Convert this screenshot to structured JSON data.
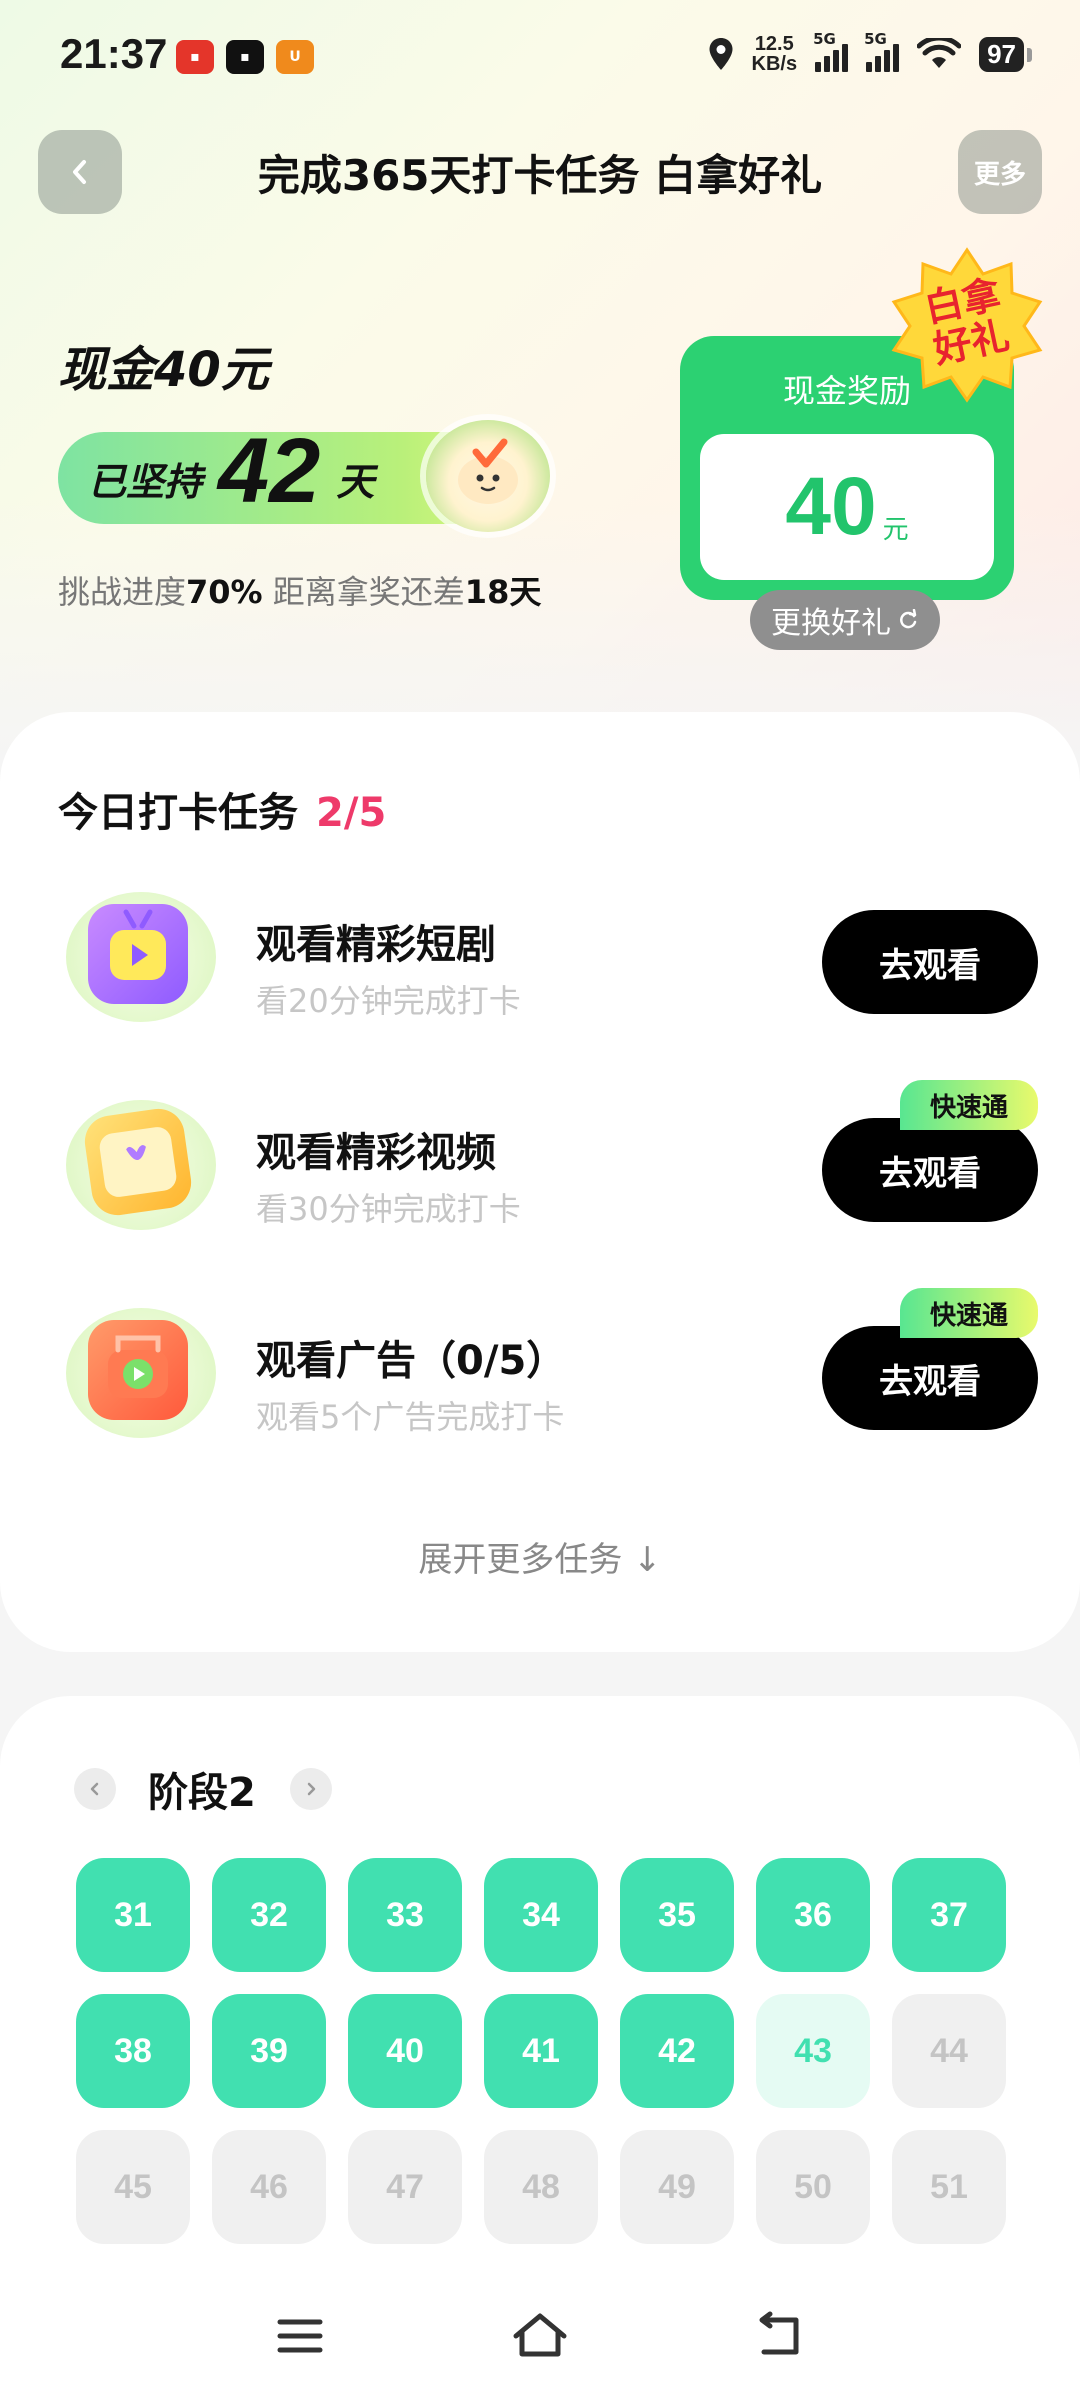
{
  "status_bar": {
    "time": "21:37",
    "net_speed_value": "12.5",
    "net_speed_unit": "KB/s",
    "signal1_label": "5G",
    "signal2_label": "5G",
    "battery": "97"
  },
  "nav": {
    "title": "完成365天打卡任务 白拿好礼",
    "more_label": "更多"
  },
  "hero": {
    "cash_title": "现金40元",
    "streak_prefix": "已坚持",
    "streak_days": "42",
    "streak_suffix": "天",
    "progress_prefix": "挑战进度",
    "progress_percent": "70%",
    "progress_mid": " 距离拿奖还差",
    "remaining_days": "18天"
  },
  "reward_card": {
    "label": "现金奖励",
    "amount": "40",
    "unit": "元",
    "badge_line1": "白拿",
    "badge_line2": "好礼",
    "swap_label": "更换好礼"
  },
  "tasks": {
    "header": "今日打卡任务",
    "count": "2/5",
    "items": [
      {
        "title": "观看精彩短剧",
        "subtitle": "看20分钟完成打卡",
        "button": "去观看",
        "tag": ""
      },
      {
        "title": "观看精彩视频",
        "subtitle": "看30分钟完成打卡",
        "button": "去观看",
        "tag": "快速通"
      },
      {
        "title": "观看广告（0/5）",
        "subtitle": "观看5个广告完成打卡",
        "button": "去观看",
        "tag": "快速通"
      }
    ],
    "expand_label": "展开更多任务 ↓"
  },
  "stage": {
    "title": "阶段2",
    "days": [
      {
        "n": "31",
        "state": "done"
      },
      {
        "n": "32",
        "state": "done"
      },
      {
        "n": "33",
        "state": "done"
      },
      {
        "n": "34",
        "state": "done"
      },
      {
        "n": "35",
        "state": "done"
      },
      {
        "n": "36",
        "state": "done"
      },
      {
        "n": "37",
        "state": "done"
      },
      {
        "n": "38",
        "state": "done"
      },
      {
        "n": "39",
        "state": "done"
      },
      {
        "n": "40",
        "state": "done"
      },
      {
        "n": "41",
        "state": "done"
      },
      {
        "n": "42",
        "state": "done"
      },
      {
        "n": "43",
        "state": "today"
      },
      {
        "n": "44",
        "state": "future"
      },
      {
        "n": "45",
        "state": "future"
      },
      {
        "n": "46",
        "state": "future"
      },
      {
        "n": "47",
        "state": "future"
      },
      {
        "n": "48",
        "state": "future"
      },
      {
        "n": "49",
        "state": "future"
      },
      {
        "n": "50",
        "state": "future"
      },
      {
        "n": "51",
        "state": "future"
      }
    ]
  },
  "colors": {
    "accent_green": "#2cd172",
    "day_done": "#41e0b0",
    "count_pink": "#ee3a6a"
  },
  "icons": {
    "back": "chevron-left-icon",
    "refresh": "refresh-icon",
    "stage_prev": "chevron-left-icon",
    "stage_next": "chevron-right-icon",
    "sys_menu": "menu-icon",
    "sys_home": "home-icon",
    "sys_back": "back-icon"
  }
}
